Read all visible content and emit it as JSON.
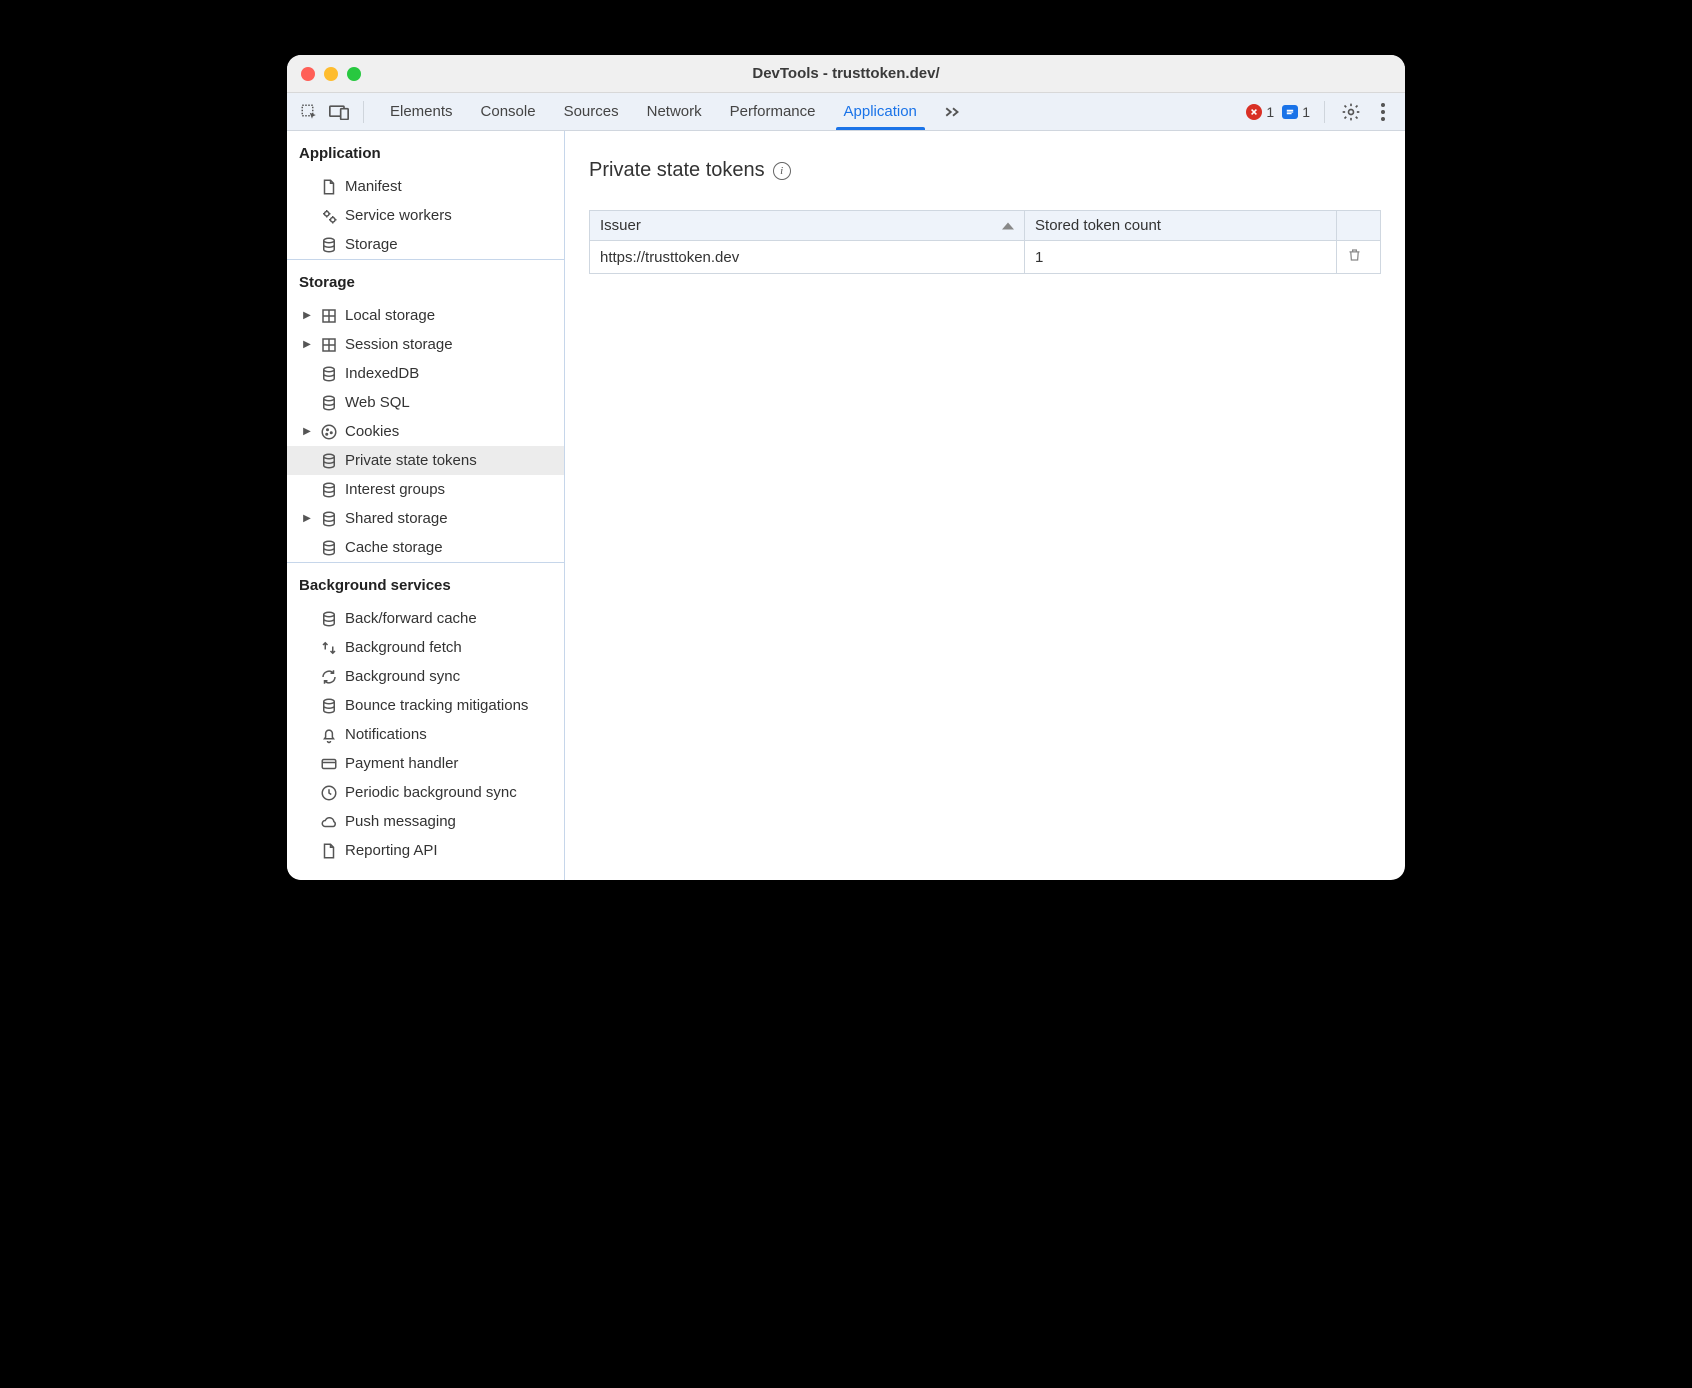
{
  "window": {
    "title": "DevTools - trusttoken.dev/"
  },
  "tabs": {
    "items": [
      "Elements",
      "Console",
      "Sources",
      "Network",
      "Performance",
      "Application"
    ],
    "activeIndex": 5
  },
  "status": {
    "errors": "1",
    "messages": "1"
  },
  "sidebar": {
    "sections": [
      {
        "title": "Application",
        "items": [
          {
            "label": "Manifest",
            "icon": "file",
            "expandable": false
          },
          {
            "label": "Service workers",
            "icon": "gears",
            "expandable": false
          },
          {
            "label": "Storage",
            "icon": "db",
            "expandable": false
          }
        ]
      },
      {
        "title": "Storage",
        "items": [
          {
            "label": "Local storage",
            "icon": "table",
            "expandable": true
          },
          {
            "label": "Session storage",
            "icon": "table",
            "expandable": true
          },
          {
            "label": "IndexedDB",
            "icon": "db",
            "expandable": false
          },
          {
            "label": "Web SQL",
            "icon": "db",
            "expandable": false
          },
          {
            "label": "Cookies",
            "icon": "cookie",
            "expandable": true
          },
          {
            "label": "Private state tokens",
            "icon": "db",
            "expandable": false,
            "selected": true
          },
          {
            "label": "Interest groups",
            "icon": "db",
            "expandable": false
          },
          {
            "label": "Shared storage",
            "icon": "db",
            "expandable": true
          },
          {
            "label": "Cache storage",
            "icon": "db",
            "expandable": false
          }
        ]
      },
      {
        "title": "Background services",
        "items": [
          {
            "label": "Back/forward cache",
            "icon": "db",
            "expandable": false
          },
          {
            "label": "Background fetch",
            "icon": "fetch",
            "expandable": false
          },
          {
            "label": "Background sync",
            "icon": "sync",
            "expandable": false
          },
          {
            "label": "Bounce tracking mitigations",
            "icon": "db",
            "expandable": false
          },
          {
            "label": "Notifications",
            "icon": "bell",
            "expandable": false
          },
          {
            "label": "Payment handler",
            "icon": "card",
            "expandable": false
          },
          {
            "label": "Periodic background sync",
            "icon": "clock",
            "expandable": false
          },
          {
            "label": "Push messaging",
            "icon": "cloud",
            "expandable": false
          },
          {
            "label": "Reporting API",
            "icon": "file",
            "expandable": false
          }
        ]
      }
    ]
  },
  "main": {
    "title": "Private state tokens",
    "table": {
      "columns": [
        "Issuer",
        "Stored token count"
      ],
      "rows": [
        {
          "issuer": "https://trusttoken.dev",
          "count": "1"
        }
      ]
    }
  }
}
